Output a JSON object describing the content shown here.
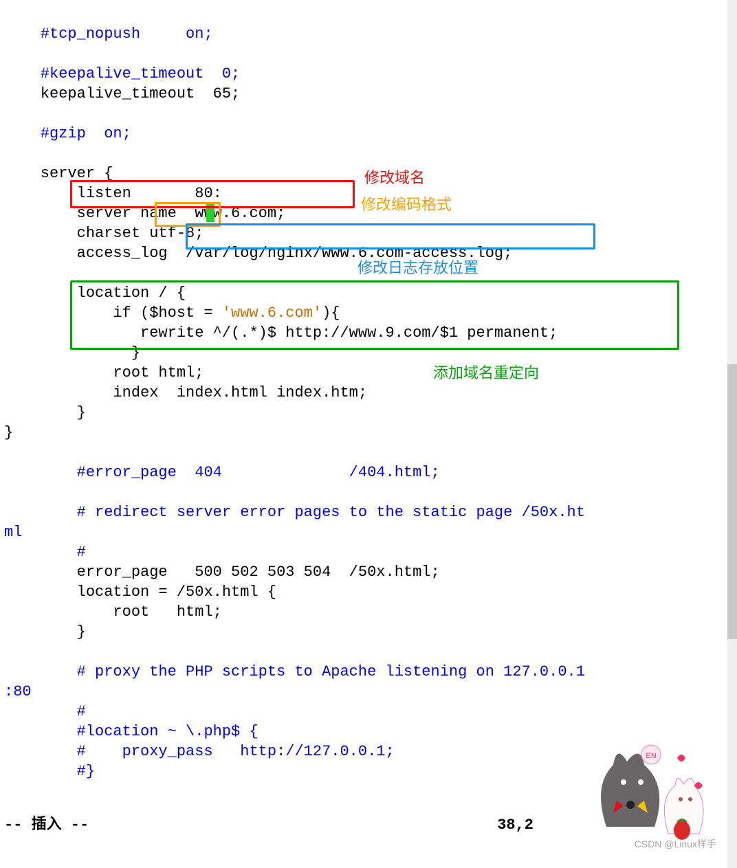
{
  "code": {
    "l1": "    #tcp_nopush     on;",
    "l2": "",
    "l3": "    #keepalive_timeout  0;",
    "l4": "    keepalive_timeout  65;",
    "l5": "",
    "l6": "    #gzip  on;",
    "l7": "",
    "l8": "    server {",
    "l9": "        listen       80:",
    "l10a": "        server name  www.6.com;",
    "l11a": "        charset ",
    "l11b": "utf-8",
    "l11c": ";",
    "l12a": "        access_log  ",
    "l12b": "/var/log/nginx/www.6.com-access.log;",
    "l13": "",
    "l14": "        location / {",
    "l15a": "            if ($host = ",
    "l15b": "'www.6.com'",
    "l15c": "){",
    "l16": "               rewrite ^/(.*)$ http://www.9.com/$1 permanent;",
    "l17": "              }",
    "l18": "            root html;",
    "l19": "            index  index.html index.htm;",
    "l20": "        }",
    "l21": "}",
    "l22": "",
    "l23": "        #error_page  404              /404.html;",
    "l24": "",
    "l25": "        # redirect server error pages to the static page /50x.ht",
    "l26": "ml",
    "l27": "        #",
    "l28": "        error_page   500 502 503 504  /50x.html;",
    "l29": "        location = /50x.html {",
    "l30": "            root   html;",
    "l31": "        }",
    "l32": "",
    "l33": "        # proxy the PHP scripts to Apache listening on 127.0.0.1",
    "l34": ":80",
    "l35": "        #",
    "l36": "        #location ~ \\.php$ {",
    "l37": "        #    proxy_pass   http://127.0.0.1;",
    "l38": "        #}"
  },
  "annotations": {
    "red": "修改域名",
    "orange": "修改编码格式",
    "blue": "修改日志存放位置",
    "green": "添加域名重定向"
  },
  "status": {
    "mode": "-- 插入 --",
    "pos": "38,2"
  },
  "watermark": "CSDN @Linux样手"
}
